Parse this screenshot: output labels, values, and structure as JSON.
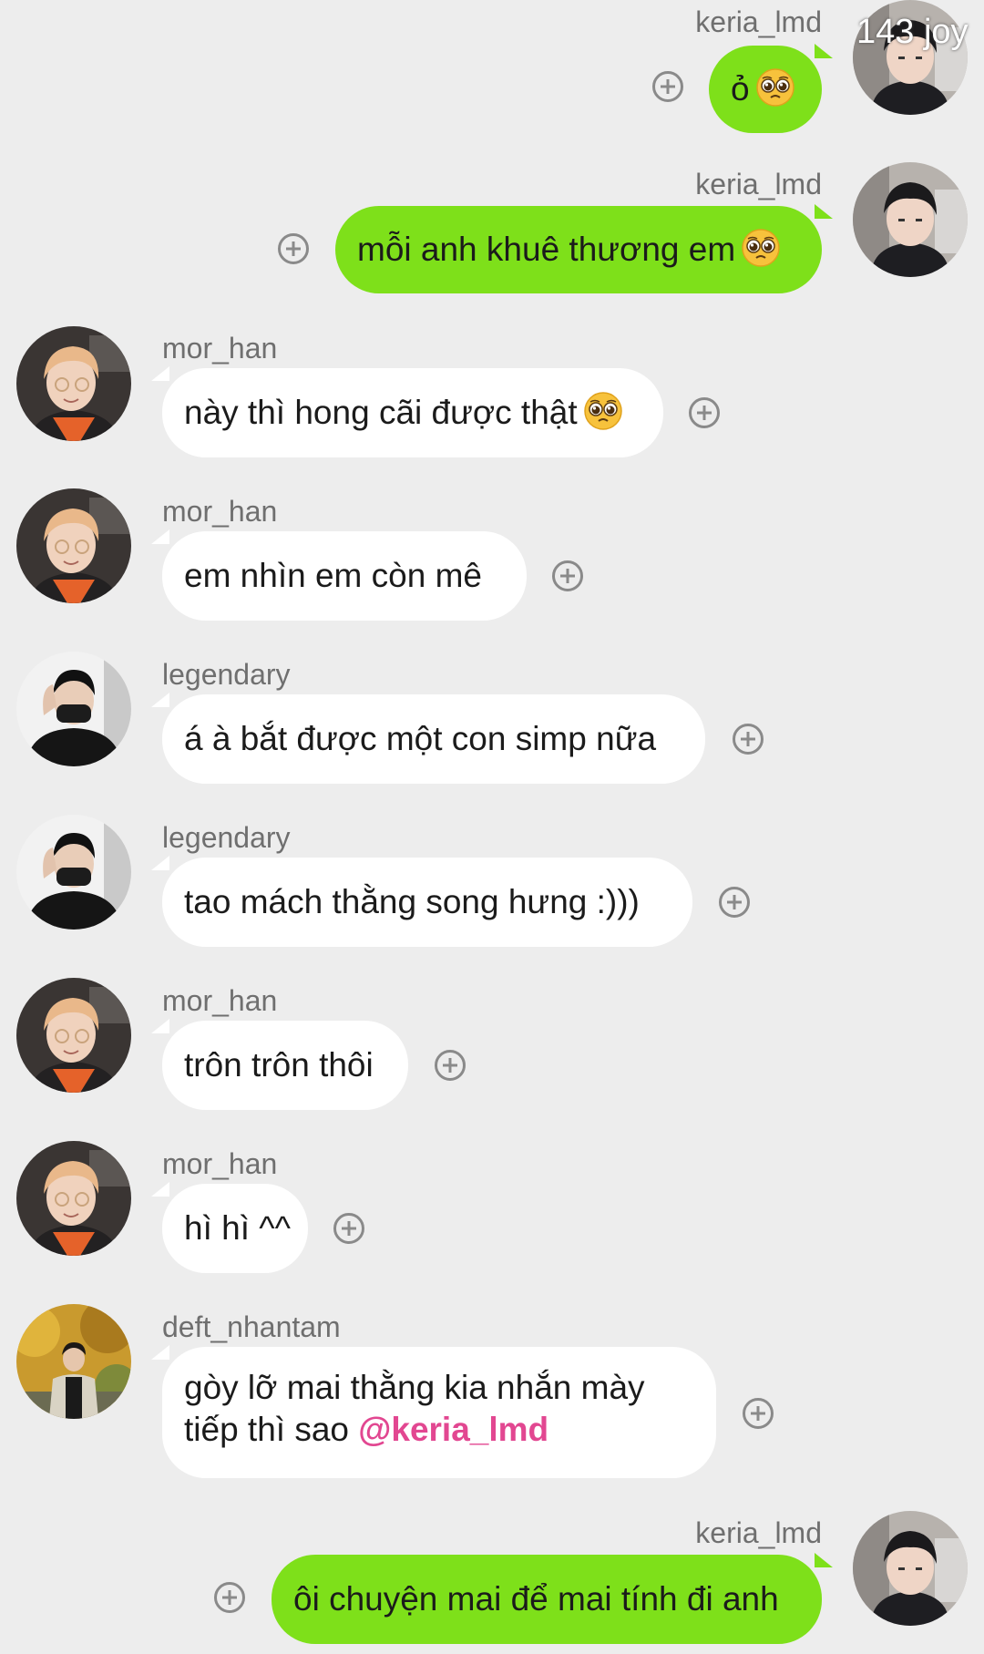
{
  "watermark": "143 joy",
  "messages": [
    {
      "sender": "keria_lmd",
      "text": "ỏ",
      "emoji": "pleading-face",
      "direction": "outgoing"
    },
    {
      "sender": "keria_lmd",
      "text": "mỗi anh khuê thương em",
      "emoji": "pleading-face",
      "direction": "outgoing"
    },
    {
      "sender": "mor_han",
      "text": "này thì hong cãi được thật",
      "emoji": "pleading-face",
      "direction": "incoming"
    },
    {
      "sender": "mor_han",
      "text": "em nhìn em còn mê",
      "direction": "incoming"
    },
    {
      "sender": "legendary",
      "text": "á à bắt được một con simp nữa",
      "direction": "incoming"
    },
    {
      "sender": "legendary",
      "text": "tao mách thằng song hưng :)))",
      "direction": "incoming"
    },
    {
      "sender": "mor_han",
      "text": "trôn trôn thôi",
      "direction": "incoming"
    },
    {
      "sender": "mor_han",
      "text": "hì hì ^^",
      "direction": "incoming"
    },
    {
      "sender": "deft_nhantam",
      "text_line1": "gòy lỡ mai thằng kia nhắn mày",
      "text_line2": "tiếp thì sao",
      "mention": "@keria_lmd",
      "direction": "incoming"
    },
    {
      "sender": "keria_lmd",
      "text": "ôi chuyện mai để mai tính đi anh",
      "direction": "outgoing"
    }
  ],
  "colors": {
    "background": "#ededed",
    "outgoing_bubble": "#7ee01a",
    "incoming_bubble": "#ffffff",
    "mention": "#e24791"
  }
}
